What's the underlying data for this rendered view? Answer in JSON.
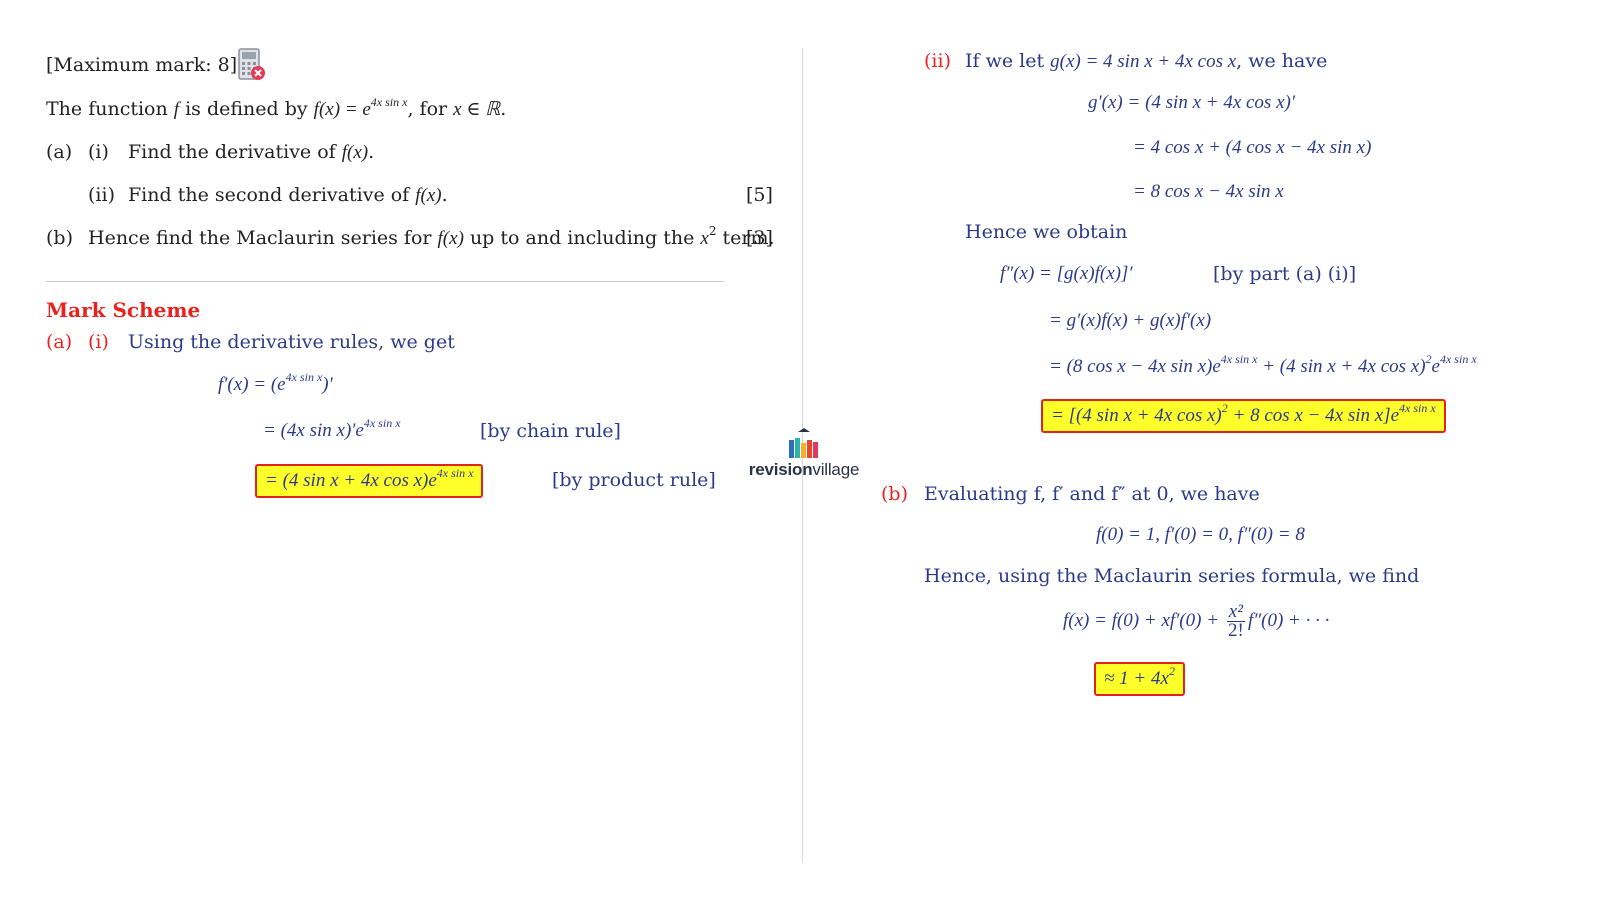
{
  "question": {
    "max_mark": "[Maximum mark: 8]",
    "calculator_icon": "no-calculator-icon",
    "intro_prefix": "The function ",
    "intro_f": "f",
    "intro_mid": " is defined by ",
    "intro_fx": "f(x) = e",
    "intro_exp": "4x sin x",
    "intro_suffix": ", for ",
    "intro_domain": "x ∈ ℝ",
    "intro_end": ".",
    "a_label": "(a)",
    "a_i_label": "(i)",
    "a_i_text": "Find the derivative of ",
    "a_i_fx": "f(x)",
    "a_ii_label": "(ii)",
    "a_ii_text": "Find the second derivative of ",
    "a_ii_fx": "f(x)",
    "a_marks": "[5]",
    "b_label": "(b)",
    "b_text": "Hence find the Maclaurin series for ",
    "b_fx": "f(x)",
    "b_text2": " up to and including the ",
    "b_x2": "x",
    "b_x2_exp": "2",
    "b_text3": " term.",
    "b_marks": "[3]"
  },
  "mark_scheme": {
    "heading": "Mark Scheme",
    "a_label": "(a)",
    "i_label": "(i)",
    "i_text": "Using the derivative rules, we get",
    "eq1_lhs": "f′(x) = (e",
    "eq1_exp": "4x sin x",
    "eq1_end": ")′",
    "eq2": "= (4x sin x)′e",
    "eq2_exp": "4x sin x",
    "eq2_note": "[by chain rule]",
    "eq3": "= (4 sin x + 4x cos x)e",
    "eq3_exp": "4x sin x",
    "eq3_note": "[by product rule]",
    "ii_label": "(ii)",
    "ii_text": "If we let ",
    "ii_g": "g(x) = 4 sin x + 4x cos x",
    "ii_text2": ", we have",
    "g1": "g′(x) = (4 sin x + 4x cos x)′",
    "g2": "= 4 cos x + (4 cos x − 4x sin x)",
    "g3": "= 8 cos x − 4x sin x",
    "hence": "Hence we obtain",
    "f1": "f″(x) = [g(x)f(x)]′",
    "f1_note": "[by part (a) (i)]",
    "f2": "= g′(x)f(x) + g(x)f′(x)",
    "f3a": "= (8 cos x − 4x sin x)e",
    "f3a_exp": "4x sin x",
    "f3b": " + (4 sin x + 4x cos x)",
    "f3b_exp": "2",
    "f3c": "e",
    "f3c_exp": "4x sin x",
    "f4a": "= [(4 sin x + 4x cos x)",
    "f4a_exp": "2",
    "f4b": " + 8 cos x − 4x sin x]e",
    "f4b_exp": "4x sin x",
    "b_label": "(b)",
    "b_text": "Evaluating f, f′ and f″ at 0, we have",
    "b_vals": "f(0) = 1,   f′(0) = 0,   f″(0) = 8",
    "b_hence": "Hence, using the Maclaurin series formula, we find",
    "m1": "f(x) = f(0) + xf′(0) + ",
    "m1_num": "x²",
    "m1_den": "2!",
    "m1_end": "f″(0) + · · ·",
    "m2": "≈ 1 + 4x",
    "m2_exp": "2"
  },
  "logo": {
    "bold": "revision",
    "light": "village",
    "bar_colors": [
      "#2c6fb4",
      "#2bb3b1",
      "#f2b227",
      "#e8472b",
      "#e03a5a"
    ]
  }
}
